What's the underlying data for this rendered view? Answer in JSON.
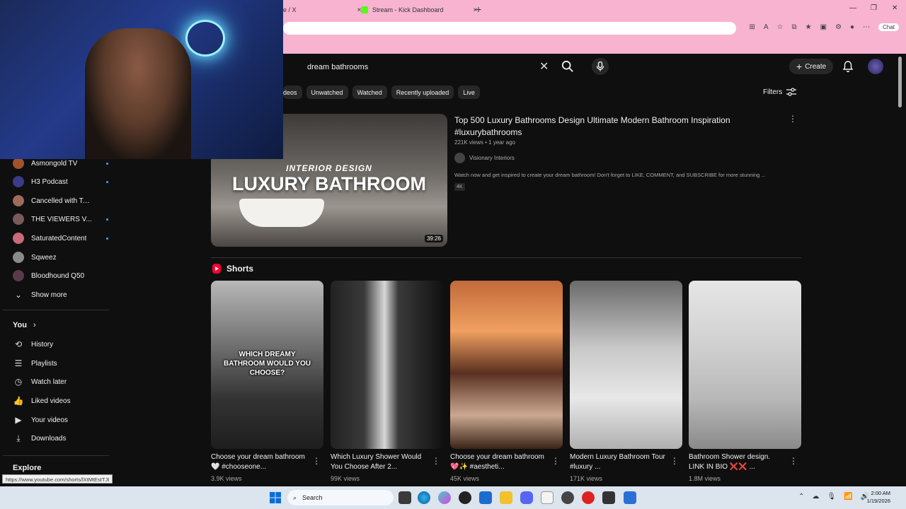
{
  "browser": {
    "tabs": [
      {
        "label": "e / X",
        "close": "×"
      },
      {
        "label": "Stream - Kick Dashboard",
        "close": "×"
      }
    ],
    "new_tab": "+",
    "copilot_label": "Chat",
    "window_controls": [
      "—",
      "❐",
      "✕"
    ]
  },
  "search": {
    "query": "dream bathrooms",
    "clear": "✕"
  },
  "header": {
    "create_label": "Create",
    "create_plus": "+"
  },
  "chips": [
    "deos",
    "Unwatched",
    "Watched",
    "Recently uploaded",
    "Live"
  ],
  "filters_label": "Filters",
  "sidebar": {
    "subscriptions": [
      {
        "label": "Asmongold TV",
        "color": "#a0522d",
        "dot": true
      },
      {
        "label": "H3 Podcast",
        "color": "#3b3b8a",
        "dot": true
      },
      {
        "label": "Cancelled with Tan...",
        "color": "#9c6b5a",
        "dot": false
      },
      {
        "label": "THE VIEWERS V...",
        "color": "#7a5a5a",
        "dot": true
      },
      {
        "label": "SaturatedContent",
        "color": "#c86a7a",
        "dot": true
      },
      {
        "label": "Sqweez",
        "color": "#8a8a8a",
        "dot": false
      },
      {
        "label": "Bloodhound Q50",
        "color": "#5a3a4a",
        "dot": false
      }
    ],
    "show_more": "Show more",
    "you_label": "You",
    "you_chevron": "›",
    "you_items": [
      {
        "label": "History",
        "icon": "history-icon"
      },
      {
        "label": "Playlists",
        "icon": "playlists-icon"
      },
      {
        "label": "Watch later",
        "icon": "watch-later-icon"
      },
      {
        "label": "Liked videos",
        "icon": "thumbs-up-icon"
      },
      {
        "label": "Your videos",
        "icon": "your-videos-icon"
      },
      {
        "label": "Downloads",
        "icon": "download-icon"
      }
    ],
    "explore_label": "Explore"
  },
  "video": {
    "title": "Top 500 Luxury Bathrooms Design Ultimate Modern Bathroom Inspiration #luxurybathrooms",
    "meta": "221K views • 1 year ago",
    "channel": "Visionary Interiors",
    "description": "Watch now and get inspired to create your dream bathroom! Don't forget to LIKE, COMMENT, and SUBSCRIBE for more stunning ...",
    "badge": "4K",
    "duration": "39:26",
    "thumb_line1": "INTERIOR DESIGN",
    "thumb_line2": "LUXURY BATHROOM"
  },
  "shorts_label": "Shorts",
  "shorts": [
    {
      "title": "Choose your dream bathroom 🤍 #chooseone...",
      "views": "3.9K views",
      "overlay": "WHICH DREAMY BATHROOM WOULD YOU CHOOSE?"
    },
    {
      "title": "Which Luxury Shower Would You Choose After 2...",
      "views": "99K views",
      "overlay": ""
    },
    {
      "title": "Choose your dream bathroom 💖✨ #aestheti...",
      "views": "45K views",
      "overlay": ""
    },
    {
      "title": "Modern Luxury Bathroom Tour #luxury ...",
      "views": "171K views",
      "overlay": ""
    },
    {
      "title": "Bathroom Shower design. LINK IN BIO ❌❌ ...",
      "views": "1.8M views",
      "overlay": ""
    }
  ],
  "status_url": "https://www.youtube.com/shorts/lXtMtEstTJI",
  "taskbar": {
    "search_label": "Search",
    "time": "2:00 AM",
    "date": "1/19/2026"
  }
}
